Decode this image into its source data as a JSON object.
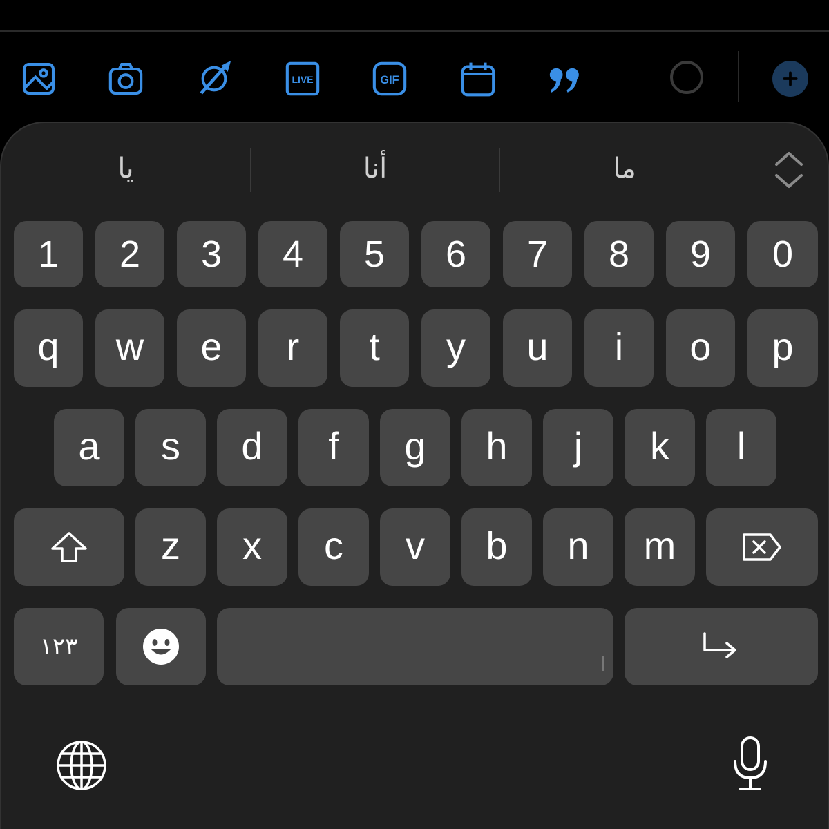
{
  "toolbar": {
    "icons": [
      "image-icon",
      "camera-icon",
      "no-location-icon",
      "live-icon",
      "gif-icon",
      "calendar-icon",
      "quote-icon"
    ],
    "live_label": "LIVE",
    "gif_label": "GIF",
    "accent_color": "#3a8fe6"
  },
  "suggestions": [
    "يا",
    "أنا",
    "ما"
  ],
  "keys": {
    "numbers": [
      "1",
      "2",
      "3",
      "4",
      "5",
      "6",
      "7",
      "8",
      "9",
      "0"
    ],
    "row1": [
      "q",
      "w",
      "e",
      "r",
      "t",
      "y",
      "u",
      "i",
      "o",
      "p"
    ],
    "row2": [
      "a",
      "s",
      "d",
      "f",
      "g",
      "h",
      "j",
      "k",
      "l"
    ],
    "row3": [
      "z",
      "x",
      "c",
      "v",
      "b",
      "n",
      "m"
    ],
    "numeric_switch": "١٢٣"
  }
}
